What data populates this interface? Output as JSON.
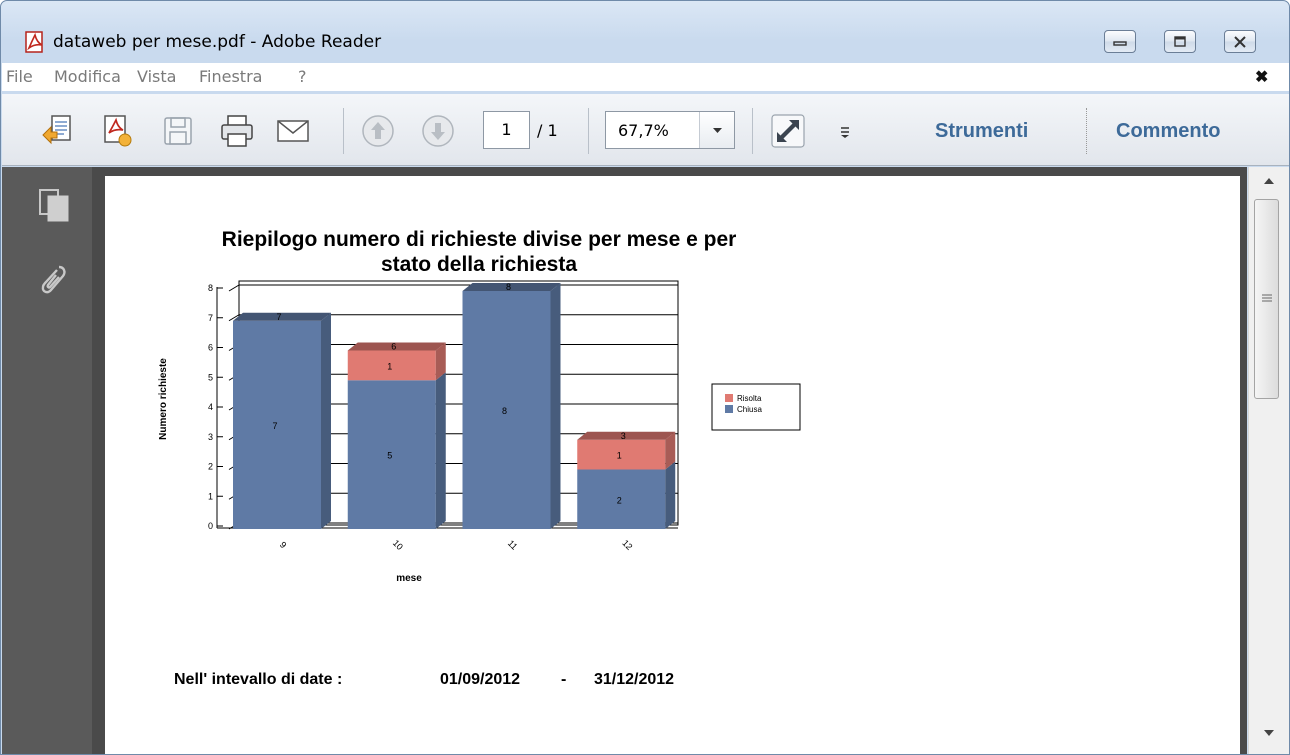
{
  "window": {
    "title": "dataweb per mese.pdf - Adobe Reader"
  },
  "menu": {
    "items": [
      "File",
      "Modifica",
      "Vista",
      "Finestra",
      "?"
    ],
    "close_glyph": "✖"
  },
  "toolbar": {
    "page_current": "1",
    "page_total": "/ 1",
    "zoom": "67,7%",
    "tools_label": "Strumenti",
    "comment_label": "Commento"
  },
  "colors": {
    "chiusa": "#5f7aa5",
    "risolta": "#e07a72",
    "accent_text": "#3d6a99"
  },
  "chart_data": {
    "type": "bar",
    "stacked": true,
    "title_line1": "Riepilogo numero di richieste divise per mese e per",
    "title_line2": "stato della richiesta",
    "xlabel": "mese",
    "ylabel": "Numero richieste",
    "categories": [
      "9",
      "10",
      "11",
      "12"
    ],
    "ylim": [
      0,
      8
    ],
    "yticks": [
      "0",
      "1",
      "2",
      "3",
      "4",
      "5",
      "6",
      "7",
      "8"
    ],
    "series": [
      {
        "name": "Chiusa",
        "values": [
          7,
          5,
          8,
          2
        ]
      },
      {
        "name": "Risolta",
        "values": [
          0,
          1,
          0,
          1
        ]
      }
    ],
    "totals": [
      7,
      6,
      8,
      3
    ],
    "legend": [
      "Risolta",
      "Chiusa"
    ]
  },
  "footer": {
    "label": "Nell' intevallo di date :",
    "date_from": "01/09/2012",
    "dash": "-",
    "date_to": "31/12/2012"
  }
}
